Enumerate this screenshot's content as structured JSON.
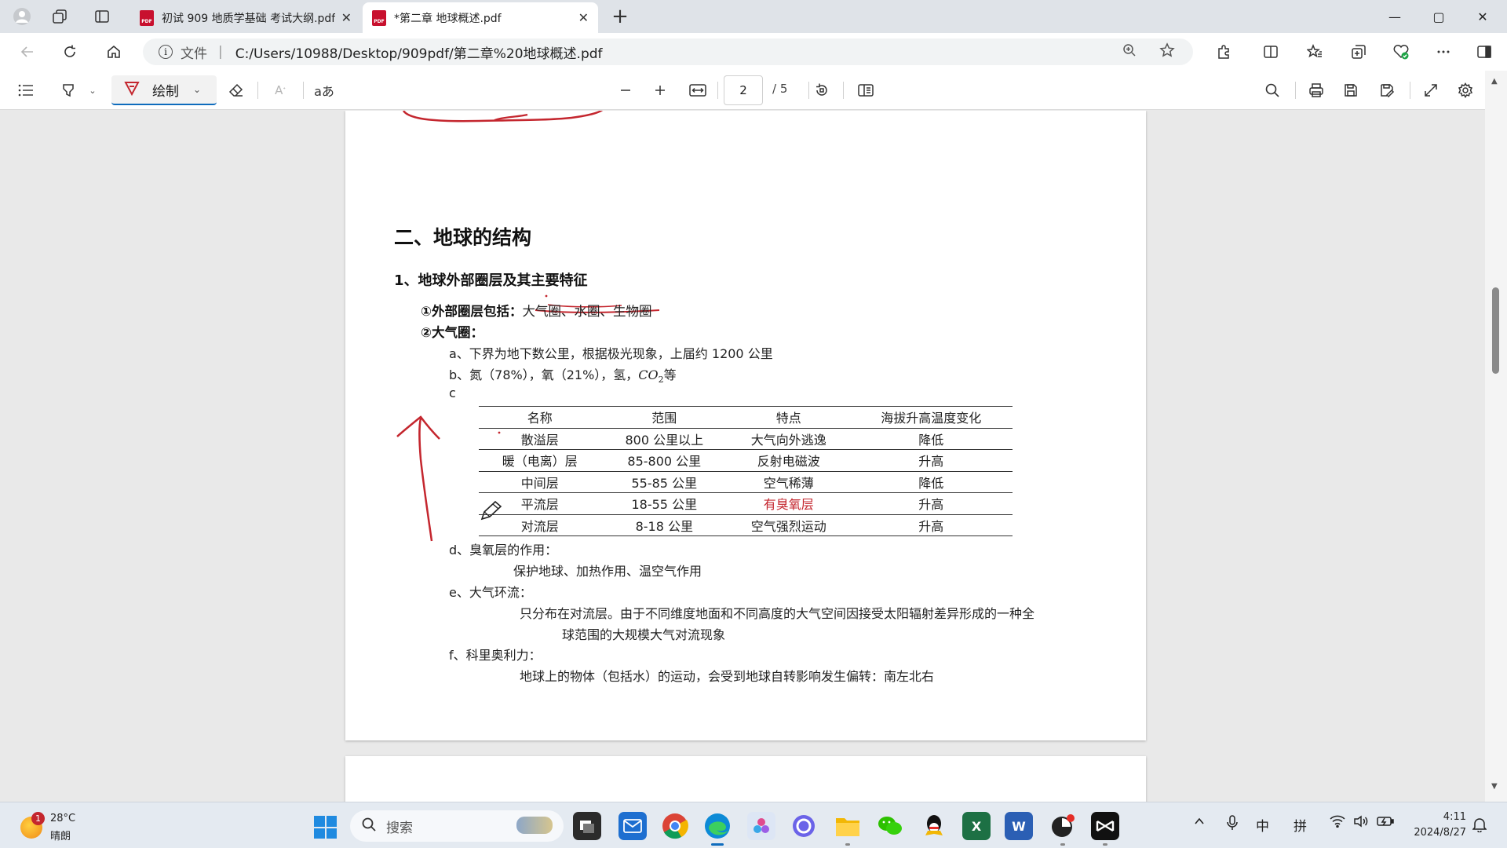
{
  "browser": {
    "tabs": [
      {
        "title": "初试 909 地质学基础 考试大纲.pdf",
        "pdf_badge": "PDF",
        "active": false
      },
      {
        "title": "*第二章 地球概述.pdf",
        "pdf_badge": "PDF",
        "active": true
      }
    ],
    "tab_close_glyph": "✕",
    "new_tab_glyph": "+",
    "window_controls": {
      "minimize": "—",
      "maximize": "▢",
      "close": "✕"
    },
    "address": {
      "info_glyph": "i",
      "scheme_label": "文件",
      "separator": "|",
      "url": "C:/Users/10988/Desktop/909pdf/第二章%20地球概述.pdf"
    }
  },
  "pdf_toolbar": {
    "draw_label": "绘制",
    "read_aloud_glyph": "aあ",
    "current_page": "2",
    "total_pages": "/ 5"
  },
  "document": {
    "section_title": "二、地球的结构",
    "subsection_title": "1、地球外部圈层及其主要特征",
    "item1_label": "①外部圈层包括：",
    "item1_value": "大气圈、水圈、生物圈",
    "item2_label": "②大气圈：",
    "line_a": "a、下界为地下数公里，根据极光现象，上届约 1200 公里",
    "line_b_prefix": "b、氮（78%），氧（21%），氢，",
    "line_b_formula": "CO",
    "line_b_sub": "2",
    "line_b_suffix": "等",
    "line_c": "c",
    "table": {
      "headers": [
        "名称",
        "范围",
        "特点",
        "海拔升高温度变化"
      ],
      "rows": [
        [
          "散溢层",
          "800 公里以上",
          "大气向外逃逸",
          "降低"
        ],
        [
          "暖（电离）层",
          "85-800 公里",
          "反射电磁波",
          "升高"
        ],
        [
          "中间层",
          "55-85 公里",
          "空气稀薄",
          "降低"
        ],
        [
          "平流层",
          "18-55 公里",
          "有臭氧层",
          "升高"
        ],
        [
          "对流层",
          "8-18 公里",
          "空气强烈运动",
          "升高"
        ]
      ],
      "highlight_cell": "有臭氧层",
      "highlight_color": "#c4262e"
    },
    "line_d": "d、臭氧层的作用：",
    "line_d_body": "保护地球、加热作用、温空气作用",
    "line_e": "e、大气环流：",
    "line_e_body1": "只分布在对流层。由于不同维度地面和不同高度的大气空间因接受太阳辐射差异形成的一种全",
    "line_e_body2": "球范围的大规模大气对流现象",
    "line_f": "f、科里奥利力：",
    "line_f_body": "地球上的物体（包括水）的运动，会受到地球自转影响发生偏转：南左北右",
    "ink_color": "#c4262e"
  },
  "taskbar": {
    "weather": {
      "temp": "28°C",
      "condition": "晴朗",
      "badge": "1"
    },
    "search_placeholder": "搜索",
    "tray": {
      "ime_lang": "中",
      "ime_mode": "拼"
    },
    "clock": {
      "time": "4:11",
      "date": "2024/8/27"
    }
  },
  "colors": {
    "accent": "#0f6cbd",
    "pdf_red": "#c8102e",
    "ink_red": "#c4262e"
  }
}
